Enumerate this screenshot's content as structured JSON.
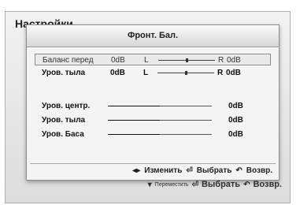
{
  "background": {
    "title": "Настройки",
    "footer": {
      "move_icon": "▾",
      "move_label": "Переместить",
      "select_icon": "⏎",
      "select_label": "Выбрать",
      "return_icon": "↶",
      "return_label": "Возвр."
    }
  },
  "dialog": {
    "title": "Фронт. Бал.",
    "balance_rows": [
      {
        "label": "Баланс перед",
        "left_value": "0dB",
        "left_mark": "L",
        "right_mark": "R",
        "right_value": "0dB",
        "position": 0.5
      },
      {
        "label": "Уров. тыла",
        "left_value": "0dB",
        "left_mark": "L",
        "right_mark": "R",
        "right_value": "0dB",
        "position": 0.5
      }
    ],
    "level_rows": [
      {
        "label": "Уров. центр.",
        "value": "0dB",
        "level": 0.5
      },
      {
        "label": "Уров. тыла",
        "value": "0dB",
        "level": 0.5
      },
      {
        "label": "Уров. Баса",
        "value": "0dB",
        "level": 0.5
      }
    ],
    "footer": {
      "change_icon": "◂▸",
      "change_label": "Изменить",
      "select_icon": "⏎",
      "select_label": "Выбрать",
      "return_icon": "↶",
      "return_label": "Возвр."
    }
  }
}
